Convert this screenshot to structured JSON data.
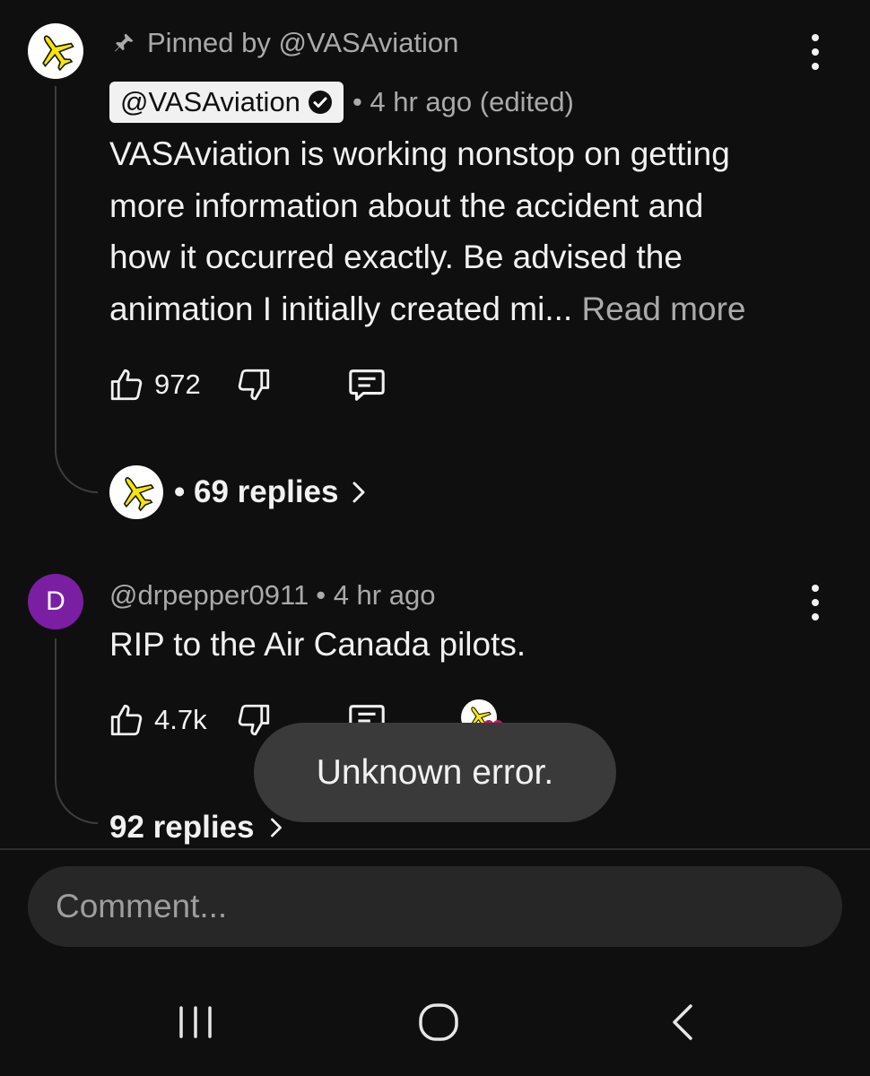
{
  "comment1": {
    "pinned_by": "Pinned by @VASAviation",
    "author": "@VASAviation",
    "time": "• 4 hr ago (edited)",
    "text_lines": [
      "VASAviation is working nonstop on getting",
      "more information about the accident and",
      "how it occurred exactly. Be advised the"
    ],
    "last_line": "animation I initially created mi...",
    "read_more": "Read more",
    "likes": "972",
    "replies": "• 69 replies"
  },
  "comment2": {
    "avatar_letter": "D",
    "author": "@drpepper0911",
    "time": "• 4 hr ago",
    "text": "RIP to the Air Canada pilots.",
    "likes": "4.7k",
    "replies": "92 replies"
  },
  "toast": {
    "text": "Unknown error."
  },
  "composer": {
    "placeholder": "Comment..."
  },
  "colors": {
    "background": "#0f0f0f",
    "avatar_d": "#7b1fa2",
    "toast_bg": "#3a3a3a",
    "composer_bg": "#272727",
    "heart": "#c2185b"
  },
  "icons": {
    "pin": "pin-icon",
    "verified": "verified-check-icon",
    "like": "thumbs-up-icon",
    "dislike": "thumbs-down-icon",
    "reply": "comment-icon",
    "more": "more-vert-icon",
    "chevron": "chevron-right-icon",
    "recents": "recent-apps-icon",
    "home": "home-icon",
    "back": "back-icon"
  }
}
